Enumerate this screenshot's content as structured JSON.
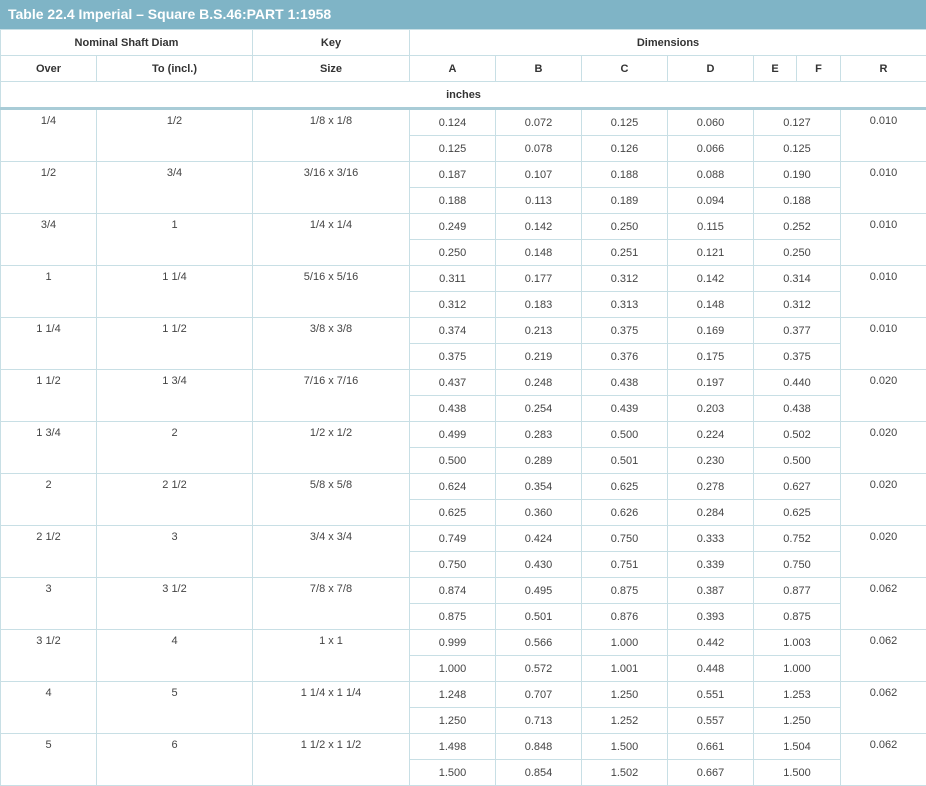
{
  "title": "Table 22.4 Imperial – Square B.S.46:PART 1:1958",
  "headers": {
    "nominal_shaft_diam": "Nominal Shaft Diam",
    "key": "Key",
    "dimensions": "Dimensions",
    "over": "Over",
    "to_incl": "To (incl.)",
    "size": "Size",
    "a": "A",
    "b": "B",
    "c": "C",
    "d": "D",
    "e": "E",
    "f": "F",
    "r": "R"
  },
  "units": "inches",
  "rows": [
    {
      "over": "1/4",
      "to": "1/2",
      "size": "1/8 x 1/8",
      "r": "0.010",
      "a": [
        "0.124",
        "0.125"
      ],
      "b": [
        "0.072",
        "0.078"
      ],
      "c": [
        "0.125",
        "0.126"
      ],
      "d": [
        "0.060",
        "0.066"
      ],
      "ef": [
        "0.127",
        "0.125"
      ]
    },
    {
      "over": "1/2",
      "to": "3/4",
      "size": "3/16 x 3/16",
      "r": "0.010",
      "a": [
        "0.187",
        "0.188"
      ],
      "b": [
        "0.107",
        "0.113"
      ],
      "c": [
        "0.188",
        "0.189"
      ],
      "d": [
        "0.088",
        "0.094"
      ],
      "ef": [
        "0.190",
        "0.188"
      ]
    },
    {
      "over": "3/4",
      "to": "1",
      "size": "1/4 x 1/4",
      "r": "0.010",
      "a": [
        "0.249",
        "0.250"
      ],
      "b": [
        "0.142",
        "0.148"
      ],
      "c": [
        "0.250",
        "0.251"
      ],
      "d": [
        "0.115",
        "0.121"
      ],
      "ef": [
        "0.252",
        "0.250"
      ]
    },
    {
      "over": "1",
      "to": "1 1/4",
      "size": "5/16 x 5/16",
      "r": "0.010",
      "a": [
        "0.311",
        "0.312"
      ],
      "b": [
        "0.177",
        "0.183"
      ],
      "c": [
        "0.312",
        "0.313"
      ],
      "d": [
        "0.142",
        "0.148"
      ],
      "ef": [
        "0.314",
        "0.312"
      ]
    },
    {
      "over": "1 1/4",
      "to": "1 1/2",
      "size": "3/8 x 3/8",
      "r": "0.010",
      "a": [
        "0.374",
        "0.375"
      ],
      "b": [
        "0.213",
        "0.219"
      ],
      "c": [
        "0.375",
        "0.376"
      ],
      "d": [
        "0.169",
        "0.175"
      ],
      "ef": [
        "0.377",
        "0.375"
      ]
    },
    {
      "over": "1 1/2",
      "to": "1 3/4",
      "size": "7/16 x 7/16",
      "r": "0.020",
      "a": [
        "0.437",
        "0.438"
      ],
      "b": [
        "0.248",
        "0.254"
      ],
      "c": [
        "0.438",
        "0.439"
      ],
      "d": [
        "0.197",
        "0.203"
      ],
      "ef": [
        "0.440",
        "0.438"
      ]
    },
    {
      "over": "1 3/4",
      "to": "2",
      "size": "1/2 x 1/2",
      "r": "0.020",
      "a": [
        "0.499",
        "0.500"
      ],
      "b": [
        "0.283",
        "0.289"
      ],
      "c": [
        "0.500",
        "0.501"
      ],
      "d": [
        "0.224",
        "0.230"
      ],
      "ef": [
        "0.502",
        "0.500"
      ]
    },
    {
      "over": "2",
      "to": "2 1/2",
      "size": "5/8 x 5/8",
      "r": "0.020",
      "a": [
        "0.624",
        "0.625"
      ],
      "b": [
        "0.354",
        "0.360"
      ],
      "c": [
        "0.625",
        "0.626"
      ],
      "d": [
        "0.278",
        "0.284"
      ],
      "ef": [
        "0.627",
        "0.625"
      ]
    },
    {
      "over": "2 1/2",
      "to": "3",
      "size": "3/4 x 3/4",
      "r": "0.020",
      "a": [
        "0.749",
        "0.750"
      ],
      "b": [
        "0.424",
        "0.430"
      ],
      "c": [
        "0.750",
        "0.751"
      ],
      "d": [
        "0.333",
        "0.339"
      ],
      "ef": [
        "0.752",
        "0.750"
      ]
    },
    {
      "over": "3",
      "to": "3 1/2",
      "size": "7/8 x 7/8",
      "r": "0.062",
      "a": [
        "0.874",
        "0.875"
      ],
      "b": [
        "0.495",
        "0.501"
      ],
      "c": [
        "0.875",
        "0.876"
      ],
      "d": [
        "0.387",
        "0.393"
      ],
      "ef": [
        "0.877",
        "0.875"
      ]
    },
    {
      "over": "3 1/2",
      "to": "4",
      "size": "1 x 1",
      "r": "0.062",
      "a": [
        "0.999",
        "1.000"
      ],
      "b": [
        "0.566",
        "0.572"
      ],
      "c": [
        "1.000",
        "1.001"
      ],
      "d": [
        "0.442",
        "0.448"
      ],
      "ef": [
        "1.003",
        "1.000"
      ]
    },
    {
      "over": "4",
      "to": "5",
      "size": "1 1/4 x 1 1/4",
      "r": "0.062",
      "a": [
        "1.248",
        "1.250"
      ],
      "b": [
        "0.707",
        "0.713"
      ],
      "c": [
        "1.250",
        "1.252"
      ],
      "d": [
        "0.551",
        "0.557"
      ],
      "ef": [
        "1.253",
        "1.250"
      ]
    },
    {
      "over": "5",
      "to": "6",
      "size": "1 1/2 x 1 1/2",
      "r": "0.062",
      "a": [
        "1.498",
        "1.500"
      ],
      "b": [
        "0.848",
        "0.854"
      ],
      "c": [
        "1.500",
        "1.502"
      ],
      "d": [
        "0.661",
        "0.667"
      ],
      "ef": [
        "1.504",
        "1.500"
      ]
    }
  ]
}
